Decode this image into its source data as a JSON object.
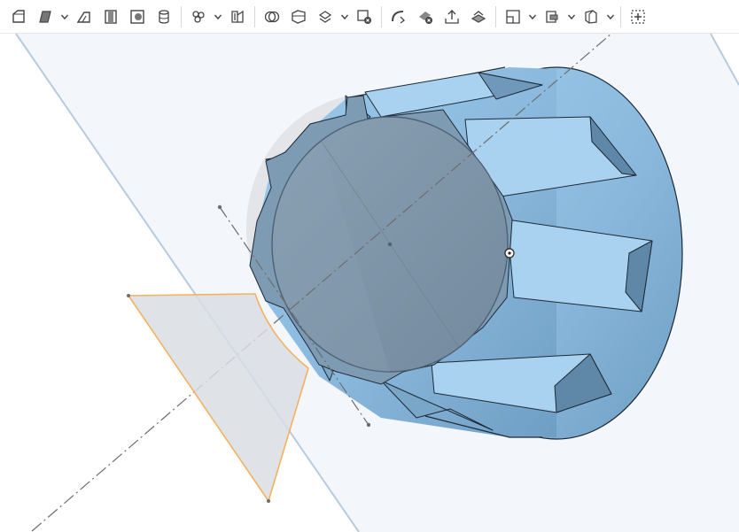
{
  "app": {
    "accent": "#1a73e8",
    "icon_color": "#444444"
  },
  "toolbar": {
    "tools": [
      {
        "name": "sketch-tool-icon",
        "dropdown": false
      },
      {
        "name": "extrude-tool-icon",
        "dropdown": true
      },
      {
        "name": "revolve-tool-icon",
        "dropdown": false
      },
      {
        "name": "sweep-tool-icon",
        "dropdown": false
      },
      {
        "name": "loft-tool-icon",
        "dropdown": false
      },
      {
        "name": "thicken-tool-icon",
        "dropdown": false
      },
      {
        "name": "fillet-tool-icon",
        "dropdown": true
      },
      {
        "name": "chamfer-tool-icon",
        "dropdown": false
      },
      {
        "name": "boolean-tool-icon",
        "dropdown": false
      },
      {
        "name": "split-tool-icon",
        "dropdown": false
      },
      {
        "name": "transform-tool-icon",
        "dropdown": true
      },
      {
        "name": "delete-part-tool-icon",
        "dropdown": false
      },
      {
        "name": "modify-fillet-tool-icon",
        "dropdown": false
      },
      {
        "name": "delete-face-tool-icon",
        "dropdown": false
      },
      {
        "name": "move-face-tool-icon",
        "dropdown": false
      },
      {
        "name": "replace-face-tool-icon",
        "dropdown": false
      },
      {
        "name": "plane-tool-icon",
        "dropdown": true
      },
      {
        "name": "mate-connector-tool-icon",
        "dropdown": true
      },
      {
        "name": "sheet-metal-tool-icon",
        "dropdown": true
      },
      {
        "name": "add-feature-tool-icon",
        "dropdown": false
      }
    ]
  },
  "viewport": {
    "background": "#ffffff",
    "plane_fill": "#f3f6fa",
    "plane_edge": "#b7cbe0",
    "part_color": "#8ab8dc",
    "part_dark": "#5f87a8",
    "sketch_face": "#7f95a8",
    "profile_fill": "#e2e5e9",
    "profile_edge": "#f2b25f"
  }
}
